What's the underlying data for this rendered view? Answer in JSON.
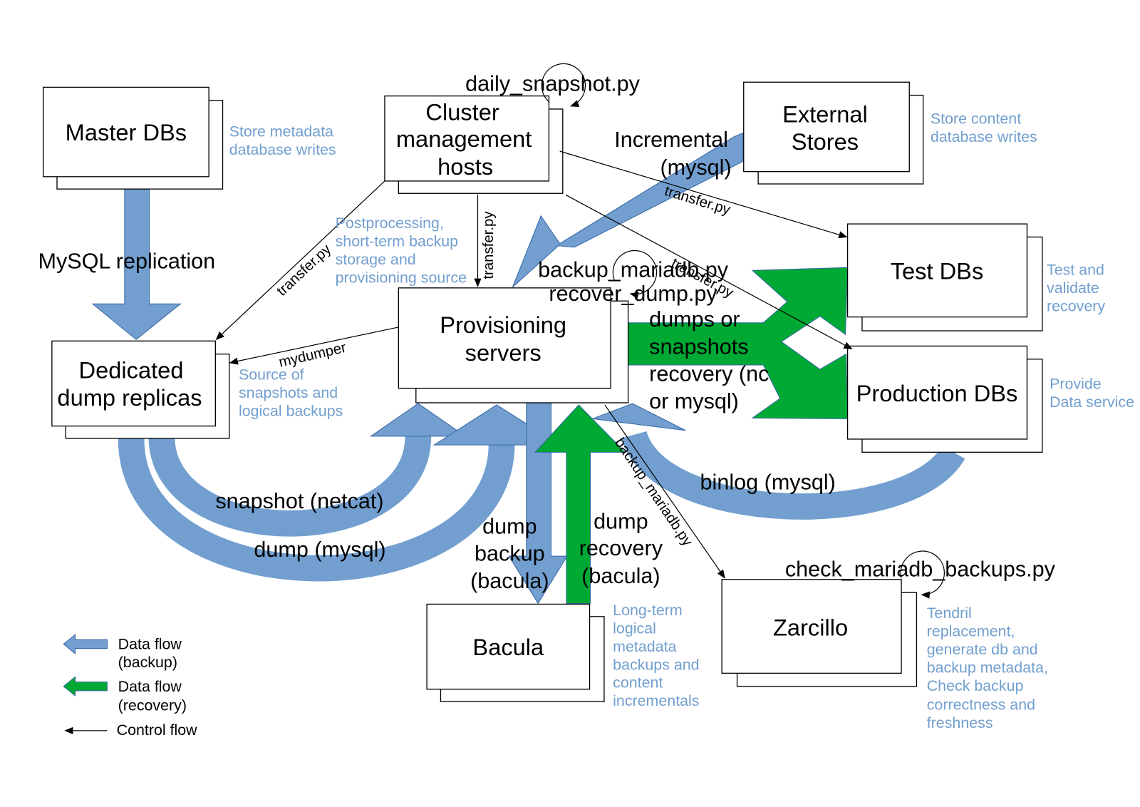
{
  "colors": {
    "backup_flow": "#729fcf",
    "recovery_flow": "#00a933",
    "control_flow": "#000000",
    "note_text": "#729fcf"
  },
  "nodes": {
    "master": {
      "lines": [
        "Master DBs"
      ],
      "note": [
        "Store metadata",
        "database writes"
      ]
    },
    "cluster": {
      "lines": [
        "Cluster",
        "management",
        "hosts"
      ],
      "script": "daily_snapshot.py"
    },
    "external": {
      "lines": [
        "External",
        "Stores"
      ],
      "note": [
        "Store content",
        "database writes"
      ]
    },
    "test": {
      "lines": [
        "Test DBs"
      ],
      "note": [
        "Test and",
        "validate",
        "recovery"
      ]
    },
    "production": {
      "lines": [
        "Production DBs"
      ],
      "note": [
        "Provide",
        "Data service"
      ]
    },
    "provisioning": {
      "lines": [
        "Provisioning",
        "servers"
      ],
      "scripts": [
        "backup_mariadb.py",
        "recover_dump.py"
      ],
      "note": [
        "Postprocessing,",
        "short-term backup",
        "storage and",
        "provisioning source"
      ]
    },
    "dedicated": {
      "lines": [
        "Dedicated",
        "dump replicas"
      ],
      "note": [
        "Source of",
        "snapshots and",
        "logical backups"
      ]
    },
    "bacula": {
      "lines": [
        "Bacula"
      ],
      "note": [
        "Long-term",
        "logical",
        "metadata",
        "backups and",
        "content",
        "incrementals"
      ]
    },
    "zarcillo": {
      "lines": [
        "Zarcillo"
      ],
      "script": "check_mariadb_backups.py",
      "note": [
        "Tendril",
        "replacement,",
        "generate db and",
        "backup metadata,",
        "Check backup",
        "correctness and",
        "freshness"
      ]
    }
  },
  "flows": {
    "replication": "MySQL replication",
    "incremental": [
      "Incremental",
      "(mysql)"
    ],
    "dumps_recovery": [
      "dumps or",
      "snapshots",
      "recovery (nc",
      "or mysql)"
    ],
    "snapshot": "snapshot (netcat)",
    "dump": "dump (mysql)",
    "dump_backup": [
      "dump",
      "backup",
      "(bacula)"
    ],
    "dump_recovery": [
      "dump",
      "recovery",
      "(bacula)"
    ],
    "binlog": "binlog (mysql)"
  },
  "control": {
    "transfer": "transfer.py",
    "mydumper": "mydumper",
    "backup_mariadb": "backup_mariadb.py"
  },
  "legend": {
    "backup": [
      "Data flow",
      "(backup)"
    ],
    "recovery": [
      "Data flow",
      "(recovery)"
    ],
    "control": "Control flow"
  }
}
